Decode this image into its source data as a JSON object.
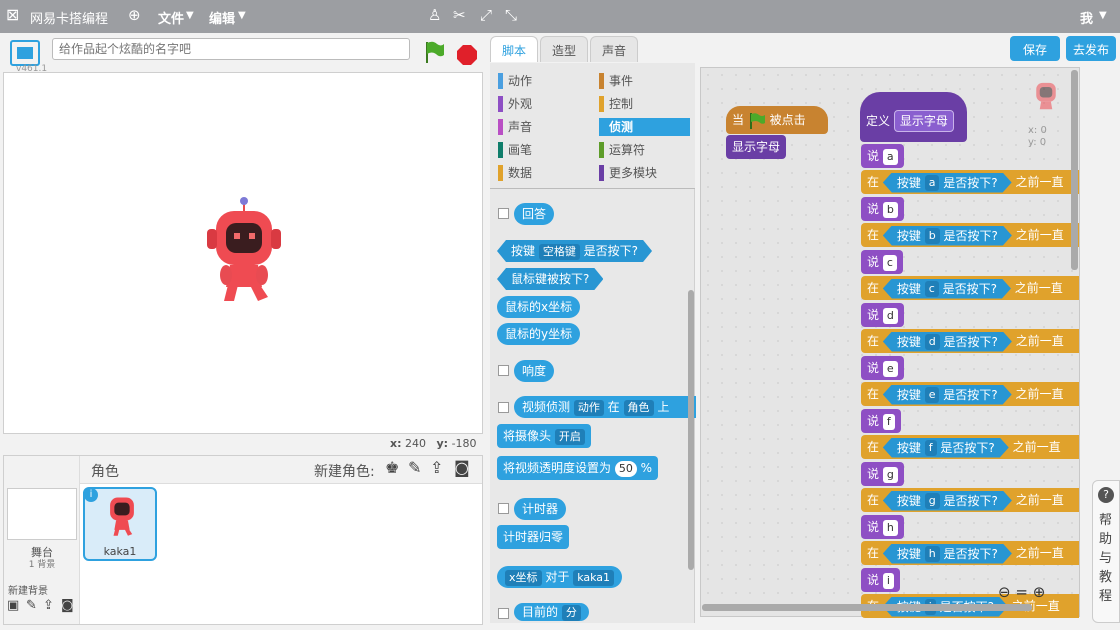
{
  "menubar": {
    "logo_text": "网易卡搭编程",
    "file": "文件",
    "edit": "编辑",
    "user": "我"
  },
  "project": {
    "title_placeholder": "给作品起个炫酷的名字吧",
    "version": "v461.1"
  },
  "stage": {
    "x_label": "x:",
    "x_value": "240",
    "y_label": "y:",
    "y_value": "-180"
  },
  "sprites": {
    "header": "角色",
    "new_sprite": "新建角色:",
    "stage_label": "舞台",
    "stage_count": "1 背景",
    "new_backdrop": "新建背景",
    "sprite_name": "kaka1"
  },
  "tabs": [
    "脚本",
    "造型",
    "声音"
  ],
  "buttons": {
    "save": "保存",
    "publish": "去发布"
  },
  "categories": [
    {
      "label": "动作",
      "color": "#4a9fe0"
    },
    {
      "label": "事件",
      "color": "#c88330"
    },
    {
      "label": "外观",
      "color": "#8e4fc4"
    },
    {
      "label": "控制",
      "color": "#e0a22c"
    },
    {
      "label": "声音",
      "color": "#b94fc4"
    },
    {
      "label": "侦测",
      "color": "#2ea1df"
    },
    {
      "label": "画笔",
      "color": "#0f7d6a"
    },
    {
      "label": "运算符",
      "color": "#5d9c29"
    },
    {
      "label": "数据",
      "color": "#e0a22c"
    },
    {
      "label": "更多模块",
      "color": "#6a3ea5"
    }
  ],
  "palette": {
    "answer": "回答",
    "key_pressed_pre": "按键",
    "key_pressed_key": "空格键",
    "key_pressed_post": "是否按下?",
    "mouse_down": "鼠标键被按下?",
    "mouse_x": "鼠标的x坐标",
    "mouse_y": "鼠标的y坐标",
    "loudness": "响度",
    "video_pre": "视频侦测",
    "video_d1": "动作",
    "video_mid": "在",
    "video_d2": "角色",
    "video_post": "上",
    "camera_pre": "将摄像头",
    "camera_dd": "开启",
    "transparency_pre": "将视频透明度设置为",
    "transparency_val": "50",
    "transparency_unit": "%",
    "timer": "计时器",
    "reset_timer": "计时器归零",
    "of_dd": "x坐标",
    "of_mid": "对于",
    "of_sprite": "kaka1",
    "current": "目前的",
    "current_dd": "分"
  },
  "scripts": {
    "hat_when": "当",
    "hat_clicked": "被点击",
    "call_block": "显示字母",
    "define": "定义",
    "define_name": "显示字母",
    "say": "说",
    "in": "在",
    "key": "按键",
    "pressed": "是否按下?",
    "before": "之前一直",
    "letters": [
      "a",
      "b",
      "c",
      "d",
      "e",
      "f",
      "g",
      "h",
      "i"
    ],
    "sprite_x": "x: 0",
    "sprite_y": "y: 0"
  },
  "help": {
    "label": "帮助与教程",
    "icon": "?"
  }
}
